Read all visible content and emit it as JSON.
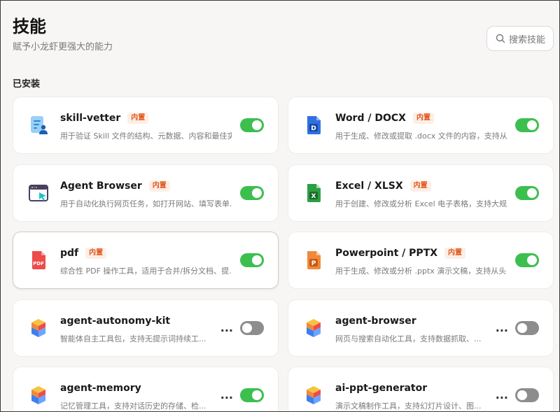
{
  "header": {
    "title": "技能",
    "subtitle": "赋予小龙虾更强大的能力",
    "search_placeholder": "搜索技能"
  },
  "section": {
    "installed_label": "已安装"
  },
  "cards": [
    {
      "name": "skill-vetter",
      "badge": "内置",
      "desc": "用于验证 Skill 文件的结构、元数据、内容和最佳实...",
      "enabled": true,
      "icon": "document-user-icon"
    },
    {
      "name": "Word / DOCX",
      "badge": "内置",
      "desc": "用于生成、修改或提取 .docx 文件的内容，支持从...",
      "enabled": true,
      "icon": "word-doc-icon"
    },
    {
      "name": "Agent Browser",
      "badge": "内置",
      "desc": "用于自动化执行网页任务，如打开网站、填写表单...",
      "enabled": true,
      "icon": "browser-window-icon"
    },
    {
      "name": "Excel / XLSX",
      "badge": "内置",
      "desc": "用于创建、修改或分析 Excel 电子表格，支持大规...",
      "enabled": true,
      "icon": "excel-sheet-icon"
    },
    {
      "name": "pdf",
      "badge": "内置",
      "desc": "综合性 PDF 操作工具，适用于合并/拆分文档、提...",
      "enabled": true,
      "icon": "pdf-file-icon"
    },
    {
      "name": "Powerpoint / PPTX",
      "badge": "内置",
      "desc": "用于生成、修改或分析 .pptx 演示文稿，支持从头...",
      "enabled": true,
      "icon": "powerpoint-file-icon"
    },
    {
      "name": "agent-autonomy-kit",
      "desc": "智能体自主工具包，支持无提示词持续工...",
      "enabled": false,
      "more": "...",
      "icon": "cube-stack-icon"
    },
    {
      "name": "agent-browser",
      "desc": "网页与搜索自动化工具，支持数据抓取、...",
      "enabled": false,
      "more": "...",
      "icon": "cube-stack-icon"
    },
    {
      "name": "agent-memory",
      "desc": "记忆管理工具，支持对话历史的存储、检...",
      "enabled": true,
      "more": "...",
      "icon": "cube-stack-icon"
    },
    {
      "name": "ai-ppt-generator",
      "desc": "演示文稿制作工具，支持幻灯片设计、图...",
      "enabled": false,
      "more": "...",
      "icon": "cube-stack-icon"
    }
  ],
  "colors": {
    "accent_on": "#3cbf4f",
    "toggle_off": "#8d8d8d",
    "badge_text": "#e0561a",
    "badge_bg": "#fdeee6"
  }
}
